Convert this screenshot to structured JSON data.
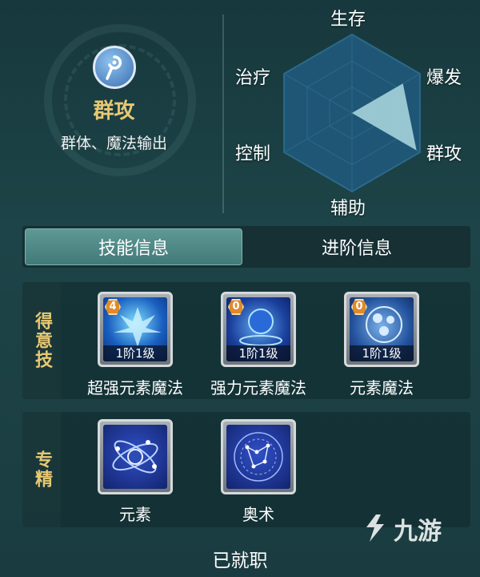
{
  "class_card": {
    "icon": "staff-icon",
    "name": "群攻",
    "description": "群体、魔法输出"
  },
  "radar": {
    "labels": [
      "生存",
      "爆发",
      "群攻",
      "辅助",
      "控制",
      "治疗"
    ],
    "values": {
      "生存": 0.0,
      "爆发": 0.75,
      "群攻": 0.95,
      "辅助": 0.0,
      "控制": 0.0,
      "治疗": 0.35
    },
    "fill_color": "#a6d4dc",
    "grid_color": "#2b6a8a"
  },
  "tabs": [
    {
      "label": "技能信息",
      "active": true
    },
    {
      "label": "进阶信息",
      "active": false
    }
  ],
  "signature_skills": {
    "section_label": "得意技",
    "items": [
      {
        "name": "超强元素魔法",
        "badge": "4",
        "level": "1阶1级",
        "icon": "storm-spell-icon"
      },
      {
        "name": "强力元素魔法",
        "badge": "0",
        "level": "1阶1级",
        "icon": "orb-spell-icon"
      },
      {
        "name": "元素魔法",
        "badge": "0",
        "level": "1阶1级",
        "icon": "elements-spell-icon"
      }
    ]
  },
  "specialties": {
    "section_label": "专精",
    "items": [
      {
        "name": "元素",
        "icon": "atom-icon"
      },
      {
        "name": "奥术",
        "icon": "constellation-icon"
      }
    ]
  },
  "footer": {
    "status": "已就职"
  },
  "watermark": {
    "text": "九游"
  }
}
